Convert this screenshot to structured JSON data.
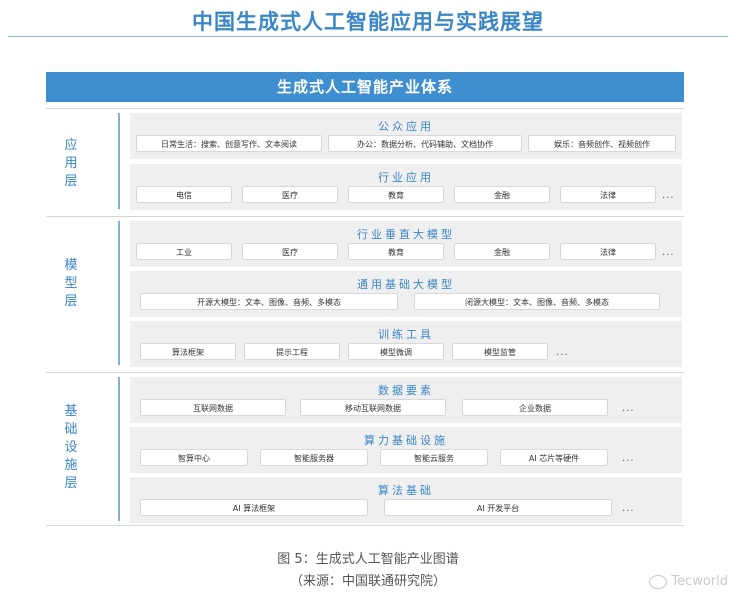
{
  "header": {
    "title": "中国生成式人工智能应用与实践展望"
  },
  "diagram": {
    "banner": "生成式人工智能产业体系",
    "layers": [
      {
        "label": [
          "应",
          "用",
          "层"
        ],
        "panels": [
          {
            "title": "公众应用",
            "items": [
              "日常生活：搜索、创意写作、文本阅读",
              "办公：数据分析、代码辅助、文档协作",
              "娱乐：音频创作、视频创作"
            ],
            "more": ""
          },
          {
            "title": "行业应用",
            "items": [
              "电信",
              "医疗",
              "教育",
              "金融",
              "法律"
            ],
            "more": "..."
          }
        ]
      },
      {
        "label": [
          "模",
          "型",
          "层"
        ],
        "panels": [
          {
            "title": "行业垂直大模型",
            "items": [
              "工业",
              "医疗",
              "教育",
              "金融",
              "法律"
            ],
            "more": "..."
          },
          {
            "title": "通用基础大模型",
            "items": [
              "开源大模型：文本、图像、音频、多模态",
              "闭源大模型：文本、图像、音频、多模态"
            ],
            "more": ""
          },
          {
            "title": "训练工具",
            "items": [
              "算法框架",
              "提示工程",
              "模型微调",
              "模型监管"
            ],
            "more": "..."
          }
        ]
      },
      {
        "label": [
          "基",
          "础",
          "设",
          "施",
          "层"
        ],
        "panels": [
          {
            "title": "数据要素",
            "items": [
              "互联网数据",
              "移动互联网数据",
              "企业数据"
            ],
            "more": "..."
          },
          {
            "title": "算力基础设施",
            "items": [
              "智算中心",
              "智能服务器",
              "智能云服务",
              "AI 芯片等硬件"
            ],
            "more": "..."
          },
          {
            "title": "算法基础",
            "items": [
              "AI 算法框架",
              "AI 开发平台"
            ],
            "more": "..."
          }
        ]
      }
    ]
  },
  "caption": {
    "line1": "图 5：生成式人工智能产业图谱",
    "line2": "（来源：中国联通研究院）"
  },
  "watermark": {
    "text": "Tecworld"
  }
}
